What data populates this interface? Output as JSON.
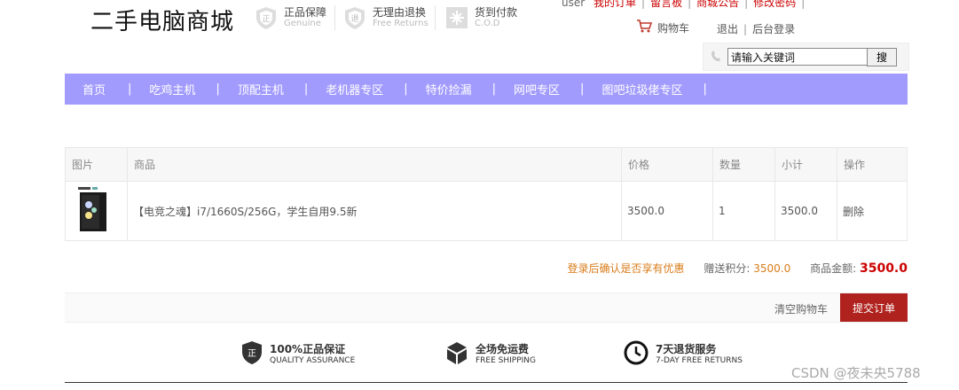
{
  "header": {
    "logo": "二手电脑商城",
    "badges": [
      {
        "title": "正品保障",
        "sub": "Genuine",
        "icon": "genuine-shield-icon"
      },
      {
        "title": "无理由退换",
        "sub": "Free Returns",
        "icon": "returns-shield-icon"
      },
      {
        "title": "货到付款",
        "sub": "C.O.D",
        "icon": "cod-icon"
      }
    ],
    "top_links": [
      "user",
      "我的订单",
      "留言板",
      "商城公告",
      "修改密码"
    ],
    "cart": "购物车",
    "logout": "退出",
    "admin": "后台登录",
    "search": {
      "value": "请输入关键词",
      "button": "搜"
    }
  },
  "nav": {
    "items": [
      "首页",
      "吃鸡主机",
      "顶配主机",
      "老机器专区",
      "特价捡漏",
      "网吧专区",
      "图吧垃圾佬专区"
    ],
    "separator": "|"
  },
  "cart_table": {
    "headers": [
      "图片",
      "商品",
      "价格",
      "数量",
      "小计",
      "操作"
    ],
    "rows": [
      {
        "name": "【电竞之魂】i7/1660S/256G，学生自用9.5新",
        "price": "3500.0",
        "qty": "1",
        "subtotal": "3500.0",
        "action": "删除"
      }
    ]
  },
  "summary": {
    "tip": "登录后确认是否享有优惠",
    "points_label": "赠送积分:",
    "points": "3500.0",
    "amount_label": "商品金额:",
    "amount": "3500.0"
  },
  "actions": {
    "clear": "清空购物车",
    "submit": "提交订单"
  },
  "footer": {
    "features": [
      {
        "title": "100%正品保证",
        "sub": "QUALITY ASSURANCE",
        "icon": "quality-shield-icon"
      },
      {
        "title": "全场免运费",
        "sub": "FREE SHIPPING",
        "icon": "box-icon"
      },
      {
        "title": "7天退货服务",
        "sub": "7-DAY FREE RETURNS",
        "icon": "clock-icon"
      }
    ]
  },
  "watermark": "CSDN @夜未央5788",
  "colors": {
    "nav": "#a29bfe",
    "submit": "#b0221e",
    "amount": "#cc0000",
    "accent": "#d97c1a"
  }
}
